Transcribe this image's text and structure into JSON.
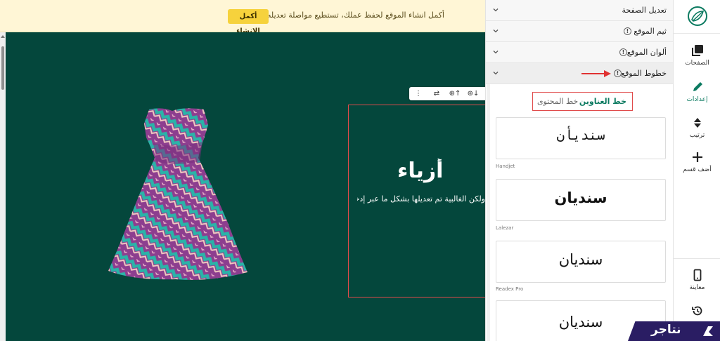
{
  "banner": {
    "message": "أكمل انشاء الموقع لحفظ عملك، تستطيع مواصلة تعديله بأي وقت",
    "button_label": "أكمل الإنشاء"
  },
  "canvas": {
    "hero_title": "أزياء",
    "hero_subtitle": "ولكن الغالبية تم تعديلها بشكل ما عبر إدخال",
    "toolbar": {
      "menu_icon": "⋮",
      "swap_icon": "⇄",
      "add_above": "⊕↑",
      "add_below": "⊕↓",
      "add": "⊕"
    }
  },
  "panel": {
    "sections": [
      {
        "label": "تعديل الصفحة",
        "info": false
      },
      {
        "label": "ثيم الموقع",
        "info": true
      },
      {
        "label": "ألوان الموقع",
        "info": true
      },
      {
        "label": "خطوط الموقع",
        "info": true
      }
    ],
    "font_tabs": {
      "active": "خط العناوين",
      "inactive": "خط المحتوى"
    },
    "fonts": [
      {
        "sample": "سنديأن",
        "name": "Handjet"
      },
      {
        "sample": "سنديان",
        "name": "Lalezar"
      },
      {
        "sample": "سنديان",
        "name": "Readex Pro"
      },
      {
        "sample": "سنديان",
        "name": ""
      }
    ]
  },
  "rail": {
    "items": [
      {
        "label": "الصفحات",
        "icon": "pages-icon"
      },
      {
        "label": "إعدادات",
        "icon": "pencil-icon"
      },
      {
        "label": "ترتيب",
        "icon": "sort-icon"
      },
      {
        "label": "أضف قسم",
        "icon": "plus-icon"
      },
      {
        "label": "معاينة",
        "icon": "mobile-preview-icon"
      },
      {
        "label": "",
        "icon": "history-icon"
      }
    ]
  },
  "watermark": {
    "text": "نتاجر"
  },
  "colors": {
    "canvas_bg": "#04473c",
    "accent": "#0b7a60",
    "banner_bg": "#fff6d6",
    "banner_button": "#f6d23c",
    "highlight": "#e04b4b",
    "watermark_bg": "#2a1d63"
  }
}
